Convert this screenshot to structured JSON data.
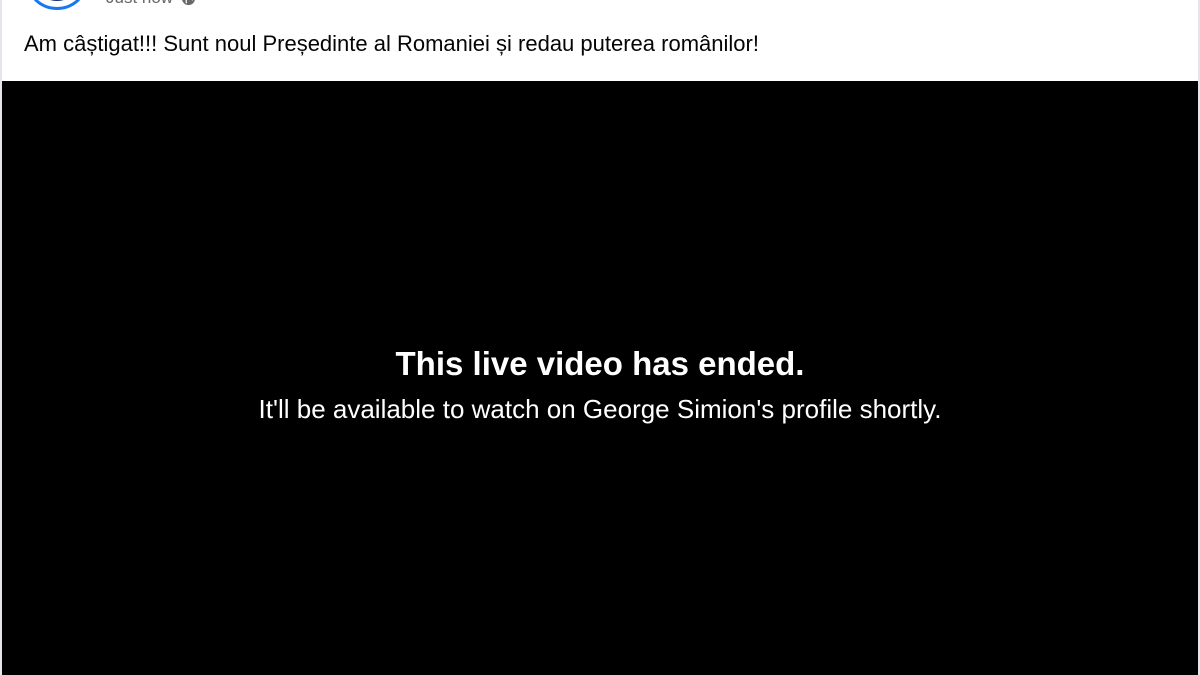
{
  "post": {
    "timestamp": "Just now",
    "privacy_icon": "globe-icon",
    "text": "Am câștigat!!! Sunt noul Președinte al Romaniei și redau puterea românilor!"
  },
  "video": {
    "status_title": "This live video has ended.",
    "status_message": "It'll be available to watch on George Simion's profile shortly."
  },
  "colors": {
    "accent": "#1877f2",
    "video_background": "#000000",
    "card_background": "#ffffff",
    "meta_text": "#65676b"
  }
}
